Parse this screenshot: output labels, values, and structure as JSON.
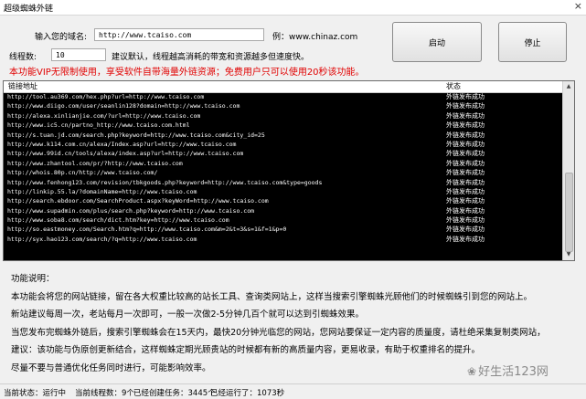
{
  "window": {
    "title": "超级蜘蛛外链",
    "close_glyph": "×"
  },
  "form": {
    "site_label": "输入您的域名:",
    "site_value": "http://www.tcaiso.com",
    "example_label": "例：www.chinaz.com",
    "thread_label": "线程数:",
    "thread_value": "10",
    "thread_hint": "建议默认，线程越高消耗的带宽和资源越多但速度快。"
  },
  "buttons": {
    "start": "启动",
    "stop": "停止"
  },
  "notice": "本功能VIP无限制使用，享受软件自带海量外链资源；免费用户只可以使用20秒该功能。",
  "list": {
    "col_url": "链接地址",
    "col_status": "状态",
    "rows": [
      {
        "url": "http://tool.au369.com/hex.php?url=http://www.tcaiso.com",
        "status": "外链发布成功"
      },
      {
        "url": "http://www.diigo.com/user/seanlin128?domain=http://www.tcaiso.com",
        "status": "外链发布成功"
      },
      {
        "url": "http://alexa.xinlianjie.com/?url=http://www.tcaiso.com",
        "status": "外链发布成功"
      },
      {
        "url": "http://www.ic5.cn/partno_http://www.tcaiso.com.html",
        "status": "外链发布成功"
      },
      {
        "url": "http://s.tuan.jd.com/search.php?keyword=http://www.tcaiso.com&city_id=25",
        "status": "外链发布成功"
      },
      {
        "url": "http://www.k114.com.cn/alexa/Index.asp?url=http://www.tcaiso.com",
        "status": "外链发布成功"
      },
      {
        "url": "http://www.99id.cn/tools/alexa/index.asp?url=http://www.tcaiso.com",
        "status": "外链发布成功"
      },
      {
        "url": "http://www.zhantool.com/pr/?http://www.tcaiso.com",
        "status": "外链发布成功"
      },
      {
        "url": "http://whois.80p.cn/http://www.tcaiso.com/",
        "status": "外链发布成功"
      },
      {
        "url": "http://www.fenhong123.com/revision/tbkgoods.php?keyword=http://www.tcaiso.com&type=goods",
        "status": "外链发布成功"
      },
      {
        "url": "http://linkip.55.la/?domainName=http://www.tcaiso.com",
        "status": "外链发布成功"
      },
      {
        "url": "http://search.ebdoor.com/SearchProduct.aspx?keyWord=http://www.tcaiso.com",
        "status": "外链发布成功"
      },
      {
        "url": "http://www.supadmin.com/plus/search.php?keyword=http://www.tcaiso.com",
        "status": "外链发布成功"
      },
      {
        "url": "http://www.soba8.com/search/dict.htm?key=http://www.tcaiso.com",
        "status": "外链发布成功"
      },
      {
        "url": "http://so.eastmoney.com/Search.htm?q=http://www.tcaiso.com&m=2&t=3&s=1&f=1&p=0",
        "status": "外链发布成功"
      },
      {
        "url": "http://syx.hao123.com/search/?q=http://www.tcaiso.com",
        "status": "外链发布成功"
      }
    ]
  },
  "info": {
    "heading": "功能说明：",
    "lines": [
      "本功能会将您的网站链接，留在各大权重比较高的站长工具、查询类网站上，这样当搜索引擎蜘蛛光顾他们的时候蜘蛛引到您的网站上。",
      "新站建议每周一次，老站每月一次即可，一般一次做2-5分钟几百个就可以达到引蜘蛛效果。",
      "当您发布完蜘蛛外链后，搜索引擎蜘蛛会在15天内，最快20分钟光临您的网站，您网站要保证一定内容的质量度，请杜绝采集复制类网站，",
      "建议：该功能与伪原创更新结合，这样蜘蛛定期光顾贵站的时候都有新的高质量内容，更易收录，有助于权重排名的提升。",
      "尽量不要与普通优化任务同时进行，可能影响效率。"
    ]
  },
  "status": {
    "state": "当前状态：运行中",
    "threads": "当前线程数：9个",
    "created": "已经创建任务：3445个",
    "runtime": "已经运行了：1073秒"
  },
  "watermark": {
    "icon": "wechat-icon",
    "glyph": "❀",
    "text": "好生活123网"
  }
}
